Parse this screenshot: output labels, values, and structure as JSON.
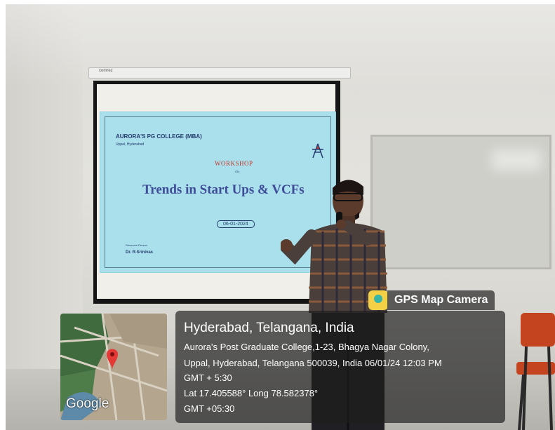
{
  "screen_case": {
    "brand": "comrez"
  },
  "slide": {
    "college": "AURORA'S PG COLLEGE (MBA)",
    "city": "Uppal, Hyderabad",
    "workshop": "WORKSHOP",
    "on": "ON",
    "title": "Trends in Start Ups & VCFs",
    "date": "06-01-2024",
    "resource_label": "Resource Person",
    "resource_name": "Dr. R.Srinivas"
  },
  "overlay": {
    "brand": "GPS Map Camera",
    "map_label": "Google",
    "location": "Hyderabad, Telangana, India",
    "address_line1": "Aurora's Post Graduate College,1-23, Bhagya Nagar Colony,",
    "address_line2": "Uppal, Hyderabad, Telangana 500039, India 06/01/24 12:03 PM",
    "gmt_line": "GMT + 5:30",
    "coords_line": "Lat 17.405588° Long 78.582378°",
    "gmt_line2": "GMT +05:30"
  },
  "colors": {
    "slide_bg": "#a9e0ec",
    "slide_title": "#3f4c98",
    "workshop_red": "#c0392b",
    "overlay_bg": "#1e1e1e",
    "map_pin": "#e53935"
  }
}
